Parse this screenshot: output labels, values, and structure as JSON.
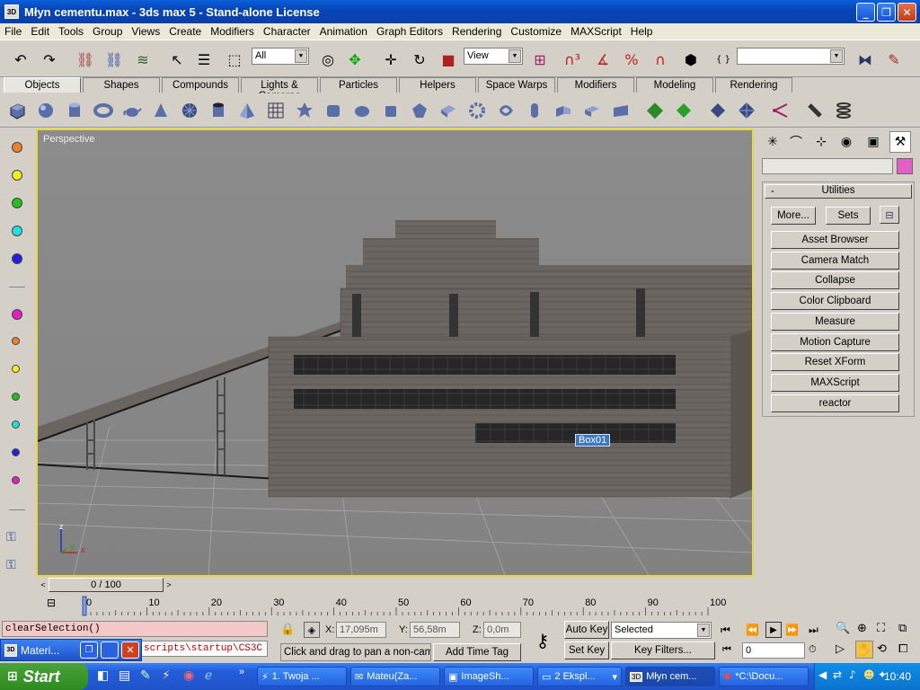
{
  "window": {
    "title": "Młyn cementu.max - 3ds max 5 - Stand-alone License",
    "app_icon": "3ds-max-icon"
  },
  "menu": [
    "File",
    "Edit",
    "Tools",
    "Group",
    "Views",
    "Create",
    "Modifiers",
    "Character",
    "Animation",
    "Graph Editors",
    "Rendering",
    "Customize",
    "MAXScript",
    "Help"
  ],
  "toolbar": {
    "selection_filter": "All",
    "reference_coord": "View",
    "named_selection": ""
  },
  "tabs": [
    "Objects",
    "Shapes",
    "Compounds",
    "Lights & Cameras",
    "Particles",
    "Helpers",
    "Space Warps",
    "Modifiers",
    "Modeling",
    "Rendering"
  ],
  "active_tab": "Objects",
  "viewport": {
    "label": "Perspective",
    "object_tooltip": "Box01",
    "axis_z": "z",
    "axis_x": "x",
    "axis_y": "y"
  },
  "command_panel": {
    "rollout_title": "Utilities",
    "collapse_sign": "-",
    "more_button": "More...",
    "sets_button": "Sets",
    "utilities": [
      "Asset Browser",
      "Camera Match",
      "Collapse",
      "Color Clipboard",
      "Measure",
      "Motion Capture",
      "Reset XForm",
      "MAXScript",
      "reactor"
    ]
  },
  "timeline": {
    "frame_counter": "0 / 100",
    "ticks": [
      "0",
      "10",
      "20",
      "30",
      "40",
      "50",
      "60",
      "70",
      "80",
      "90",
      "100"
    ]
  },
  "status": {
    "listener_line1": "clearSelection()",
    "listener_line2": "scripts\\startup\\CS3C",
    "x_label": "X:",
    "x_value": "17,095m",
    "y_label": "Y:",
    "y_value": "56,58m",
    "z_label": "Z:",
    "z_value": "0,0m",
    "prompt": "Click and drag to pan a non-camer",
    "add_time_tag": "Add Time Tag",
    "auto_key": "Auto Key",
    "set_key": "Set Key",
    "selected_dropdown": "Selected",
    "key_filters": "Key Filters...",
    "current_frame": "0"
  },
  "mini_window": {
    "title": "Materi..."
  },
  "taskbar": {
    "start": "Start",
    "tasks": [
      "1. Twoja ...",
      "Mateu(Za...",
      "ImageSh...",
      "2 Ekspl...",
      "Młyn cem...",
      "*C:\\Docu..."
    ],
    "active_task_index": 4,
    "clock": "10:40"
  }
}
